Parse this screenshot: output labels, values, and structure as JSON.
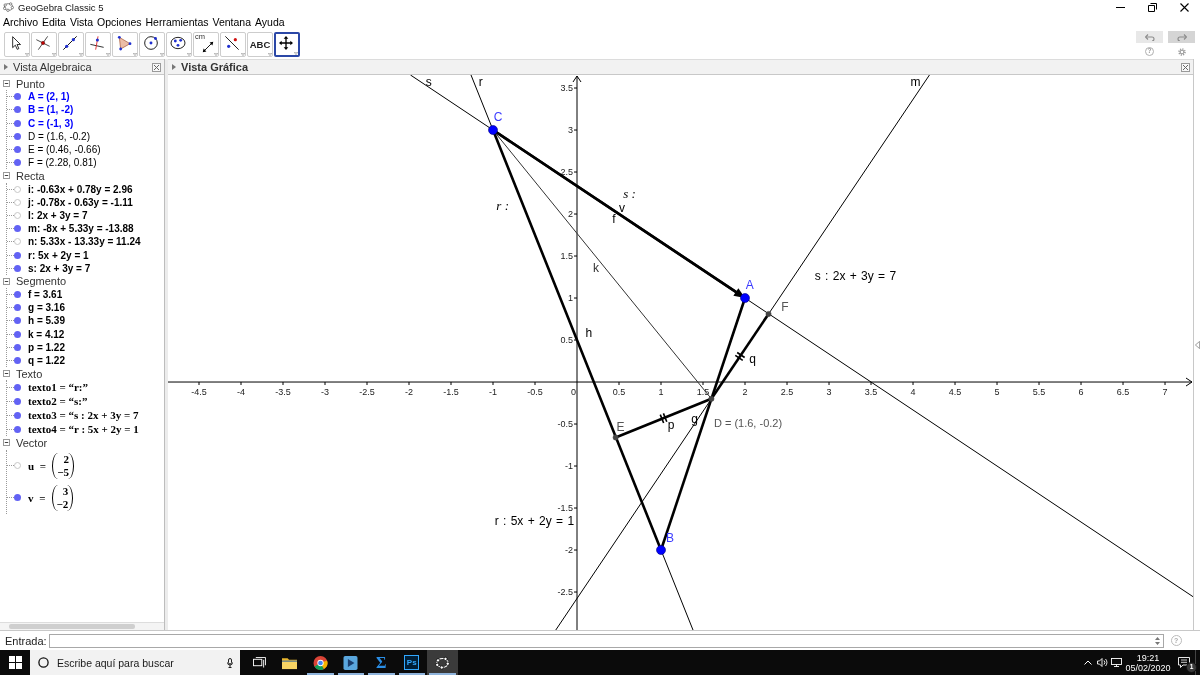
{
  "window": {
    "title": "GeoGebra Classic 5"
  },
  "menu": [
    "Archivo",
    "Edita",
    "Vista",
    "Opciones",
    "Herramientas",
    "Ventana",
    "Ayuda"
  ],
  "toolbar": {
    "tools": [
      {
        "kind": "move",
        "selected": false
      },
      {
        "kind": "intersect",
        "selected": false
      },
      {
        "kind": "line",
        "selected": false
      },
      {
        "kind": "perpendicular",
        "selected": false
      },
      {
        "kind": "polygon",
        "selected": false
      },
      {
        "kind": "circle",
        "selected": false
      },
      {
        "kind": "ellipse",
        "selected": false
      },
      {
        "kind": "distance",
        "text": "cm",
        "selected": false
      },
      {
        "kind": "reflect",
        "selected": false
      },
      {
        "kind": "text",
        "text": "ABC",
        "selected": false
      },
      {
        "kind": "pan",
        "selected": true
      }
    ],
    "help": "?"
  },
  "algebra_view": {
    "title": "Vista Algebraica",
    "categories": [
      {
        "name": "Punto",
        "expanded": true,
        "items": [
          {
            "kind": "plain",
            "text": "A = (2, 1)",
            "visible": true,
            "free": true
          },
          {
            "kind": "plain",
            "text": "B = (1, -2)",
            "visible": true,
            "free": true
          },
          {
            "kind": "plain",
            "text": "C = (-1, 3)",
            "visible": true,
            "free": true
          },
          {
            "kind": "plain",
            "text": "D = (1.6, -0.2)",
            "visible": true,
            "free": false
          },
          {
            "kind": "plain",
            "text": "E = (0.46, -0.66)",
            "visible": true,
            "free": false
          },
          {
            "kind": "plain",
            "text": "F = (2.28, 0.81)",
            "visible": true,
            "free": false
          }
        ]
      },
      {
        "name": "Recta",
        "expanded": true,
        "items": [
          {
            "kind": "plain",
            "text": "i: -0.63x + 0.78y = 2.96",
            "visible": false
          },
          {
            "kind": "plain",
            "text": "j: -0.78x - 0.63y = -1.11",
            "visible": false
          },
          {
            "kind": "plain",
            "text": "l: 2x + 3y = 7",
            "visible": false
          },
          {
            "kind": "plain",
            "text": "m: -8x + 5.33y = -13.88",
            "visible": true
          },
          {
            "kind": "plain",
            "text": "n: 5.33x - 13.33y = 11.24",
            "visible": false
          },
          {
            "kind": "plain",
            "text": "r: 5x + 2y = 1",
            "visible": true
          },
          {
            "kind": "plain",
            "text": "s: 2x + 3y = 7",
            "visible": true
          }
        ]
      },
      {
        "name": "Segmento",
        "expanded": true,
        "items": [
          {
            "kind": "plain",
            "text": "f = 3.61",
            "visible": true
          },
          {
            "kind": "plain",
            "text": "g = 3.16",
            "visible": true
          },
          {
            "kind": "plain",
            "text": "h = 5.39",
            "visible": true
          },
          {
            "kind": "plain",
            "text": "k = 4.12",
            "visible": true
          },
          {
            "kind": "plain",
            "text": "p = 1.22",
            "visible": true
          },
          {
            "kind": "plain",
            "text": "q = 1.22",
            "visible": true
          }
        ]
      },
      {
        "name": "Texto",
        "expanded": true,
        "items": [
          {
            "kind": "latex",
            "text": "texto1 = “r:”",
            "visible": true
          },
          {
            "kind": "latex",
            "text": "texto2 = “s:”",
            "visible": true
          },
          {
            "kind": "latex",
            "text": "texto3 = “s : 2x + 3y = 7",
            "visible": true
          },
          {
            "kind": "latex",
            "text": "texto4 = “r : 5x + 2y = 1",
            "visible": true
          }
        ]
      },
      {
        "name": "Vector",
        "expanded": true,
        "items": [
          {
            "kind": "matrix",
            "text": "u =",
            "entries": [
              "2",
              "−5"
            ],
            "visible": false
          },
          {
            "kind": "matrix",
            "text": "v =",
            "entries": [
              "3",
              "−2"
            ],
            "visible": true
          }
        ]
      }
    ]
  },
  "graphics_view": {
    "title": "Vista Gráfica",
    "x_axis": {
      "tick_labels": [
        "-4.5",
        "-4",
        "-3.5",
        "-3",
        "-2.5",
        "-2",
        "-1.5",
        "-1",
        "-0.5",
        "0",
        "0.5",
        "1",
        "1.5",
        "2",
        "2.5",
        "3",
        "3.5",
        "4",
        "4.5",
        "5",
        "5.5",
        "6",
        "6.5",
        "7"
      ]
    },
    "y_axis": {
      "tick_labels": [
        "3.5",
        "3",
        "2.5",
        "2",
        "1.5",
        "1",
        "0.5",
        "-0.5",
        "-1",
        "-1.5",
        "-2",
        "-2.5"
      ]
    },
    "lines": [
      {
        "label": "s"
      },
      {
        "label": "r"
      },
      {
        "label": "m"
      }
    ],
    "segments": [
      {
        "kind": "thin",
        "label": "k",
        "tick_marks": false
      },
      {
        "kind": "thick",
        "label": "h",
        "tick_marks": false
      },
      {
        "kind": "thick",
        "label": "f",
        "tick_marks": false
      },
      {
        "kind": "thick",
        "label": "g",
        "tick_marks": false
      },
      {
        "kind": "thick",
        "label": "p",
        "tick_marks": true
      },
      {
        "kind": "thick",
        "label": "q",
        "tick_marks": true
      }
    ],
    "vectors": [
      {
        "label": "v"
      }
    ],
    "points": [
      {
        "label": "C",
        "free": true
      },
      {
        "label": "A",
        "free": true
      },
      {
        "label": "B",
        "free": true
      },
      {
        "label": "D = (1.6, -0.2)",
        "free": false
      },
      {
        "label": "E",
        "free": false
      },
      {
        "label": "F",
        "free": false
      }
    ],
    "texts": [
      {
        "kind": "math",
        "text": "s :"
      },
      {
        "kind": "math",
        "text": "r :"
      },
      {
        "kind": "formula",
        "text": "s : 2x + 3y = 7"
      },
      {
        "kind": "formula",
        "text": "r : 5x + 2y = 1"
      }
    ]
  },
  "input_bar": {
    "label": "Entrada:",
    "help": "?"
  },
  "taskbar": {
    "search": {
      "placeholder": "Escribe aquí para buscar"
    },
    "apps": [
      {
        "kind": "task_view",
        "running": false,
        "selected": false
      },
      {
        "kind": "folder",
        "running": false,
        "selected": false
      },
      {
        "kind": "browser",
        "running": true,
        "selected": false
      },
      {
        "kind": "media",
        "running": true,
        "selected": false
      },
      {
        "kind": "sigma",
        "text": "Σ",
        "running": true,
        "selected": false
      },
      {
        "kind": "photoshop",
        "text": "Ps",
        "running": true,
        "selected": false
      },
      {
        "kind": "geogebra",
        "running": true,
        "selected": true
      }
    ],
    "clock": {
      "time": "19:21",
      "date": "05/02/2020"
    },
    "notifications": "1"
  }
}
